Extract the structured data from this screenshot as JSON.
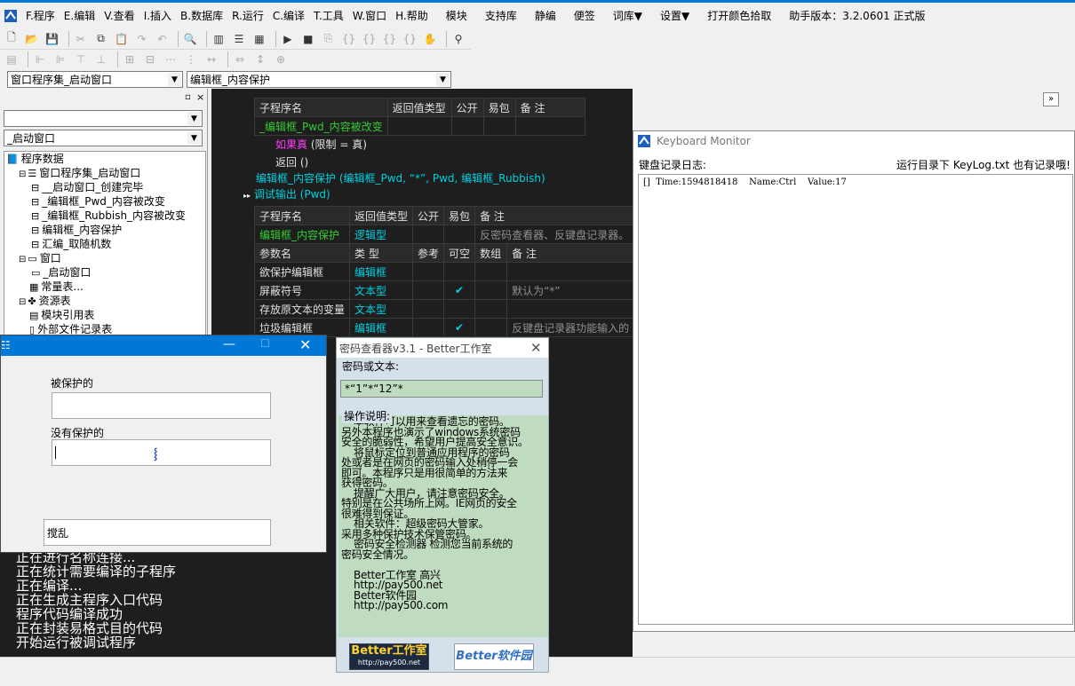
{
  "menubar": {
    "items": [
      "F.程序",
      "E.编辑",
      "V.查看",
      "I.插入",
      "B.数据库",
      "R.运行",
      "C.编译",
      "T.工具",
      "W.窗口",
      "H.帮助"
    ],
    "extra": [
      "模块",
      "支持库",
      "静编",
      "便签",
      "词库▼",
      "设置▼",
      "打开颜色拾取",
      "助手版本：3.2.0601 正式版"
    ]
  },
  "combos": {
    "window_set": "窗口程序集_启动窗口",
    "subprogram": "编辑框_内容保护",
    "left_top": "",
    "left_window": "_启动窗口"
  },
  "tree": {
    "items": [
      {
        "label": "程序数据",
        "indent": 0,
        "icon": "book"
      },
      {
        "label": "窗口程序集_启动窗口",
        "indent": 1,
        "icon": "stack"
      },
      {
        "label": "__启动窗口_创建完毕",
        "indent": 2,
        "icon": "sub"
      },
      {
        "label": "_编辑框_Pwd_内容被改变",
        "indent": 2,
        "icon": "sub"
      },
      {
        "label": "_编辑框_Rubbish_内容被改变",
        "indent": 2,
        "icon": "sub"
      },
      {
        "label": "编辑框_内容保护",
        "indent": 2,
        "icon": "sub"
      },
      {
        "label": "汇编_取随机数",
        "indent": 2,
        "icon": "sub"
      },
      {
        "label": "窗口",
        "indent": 1,
        "icon": "window"
      },
      {
        "label": "_启动窗口",
        "indent": 2,
        "icon": "window"
      },
      {
        "label": "常量表...",
        "indent": 1,
        "icon": "const"
      },
      {
        "label": "资源表",
        "indent": 1,
        "icon": "res"
      },
      {
        "label": "模块引用表",
        "indent": 1,
        "icon": "mod"
      },
      {
        "label": "外部文件记录表",
        "indent": 1,
        "icon": "file"
      }
    ]
  },
  "code": {
    "table1": {
      "headers": [
        "子程序名",
        "返回值类型",
        "公开",
        "易包",
        "备 注"
      ],
      "name": "_编辑框_Pwd_内容被改变"
    },
    "line_if": "如果真",
    "line_if_cond": "(限制 = 真)",
    "line_return": "返回 ()",
    "line_call": "编辑框_内容保护 (编辑框_Pwd, “*”, Pwd, 编辑框_Rubbish)",
    "line_debug": "调试输出 (Pwd)",
    "table2": {
      "headers": [
        "子程序名",
        "返回值类型",
        "公开",
        "易包",
        "备 注"
      ],
      "row": {
        "name": "编辑框_内容保护",
        "type": "逻辑型",
        "note": "反密码查看器、反键盘记录器。"
      },
      "param_headers": [
        "参数名",
        "类 型",
        "参考",
        "可空",
        "数组",
        "备 注"
      ],
      "params": [
        {
          "name": "欲保护编辑框",
          "type": "编辑框",
          "ref": "",
          "opt": "",
          "arr": "",
          "note": ""
        },
        {
          "name": "屏蔽符号",
          "type": "文本型",
          "ref": "",
          "opt": "✔",
          "arr": "",
          "note": "默认为“*”"
        },
        {
          "name": "存放原文本的变量",
          "type": "文本型",
          "ref": "",
          "opt": "",
          "arr": "",
          "note": ""
        },
        {
          "name": "垃圾编辑框",
          "type": "编辑框",
          "ref": "",
          "opt": "✔",
          "arr": "",
          "note": "反键盘记录器功能输入的"
        }
      ]
    }
  },
  "output": {
    "lines": [
      "正在进行名称连接...",
      "正在统计需要编译的子程序",
      "正在编译...",
      "正在生成主程序入口代码",
      "程序代码编译成功",
      "正在封装易格式目的代码",
      "开始运行被调试程序"
    ]
  },
  "keyboard_monitor": {
    "title": "Keyboard Monitor",
    "log_label": "键盘记录日志:",
    "hint": "运行目录下 KeyLog.txt 也有记录哦!",
    "log": "[]  Time:1594818418    Name:Ctrl    Value:17"
  },
  "pwd_viewer": {
    "title": "密码查看器v3.1 - Better工作室",
    "group1": "密码或文本:",
    "value": "*“1”*“12”*",
    "group2": "操作说明:",
    "desc": "    本软件可以用来查看遗忘的密码。\n另外本程序也演示了windows系统密码\n安全的脆弱性，希望用户提高安全意识。\n    将鼠标定位到普通应用程序的密码\n处或者是在网页的密码输入处稍停一会\n即可。本程序只是用很简单的方法来\n获得密码。\n    提醒广大用户，请注意密码安全。\n特别是在公共场所上网。IE网页的安全\n很难得到保证。\n    相关软件：超级密码大管家。\n采用多种保护技术保管密码。\n    密码安全检测器 检测您当前系统的\n密码安全情况。\n\n    Better工作室 高兴\n    http://pay500.net\n    Better软件园\n    http://pay500.com",
    "logo1": "Better工作室",
    "logo1_url": "http://pay500.net",
    "logo2": "Better软件园"
  },
  "protect_window": {
    "label1": "被保护的",
    "label2": "没有保护的",
    "field3": "搅乱"
  },
  "colors": {
    "accent": "#0078d7",
    "code_bg": "#1e1e1e",
    "green": "#33cc33",
    "cyan": "#00d0e0",
    "note_gray": "#909090"
  }
}
